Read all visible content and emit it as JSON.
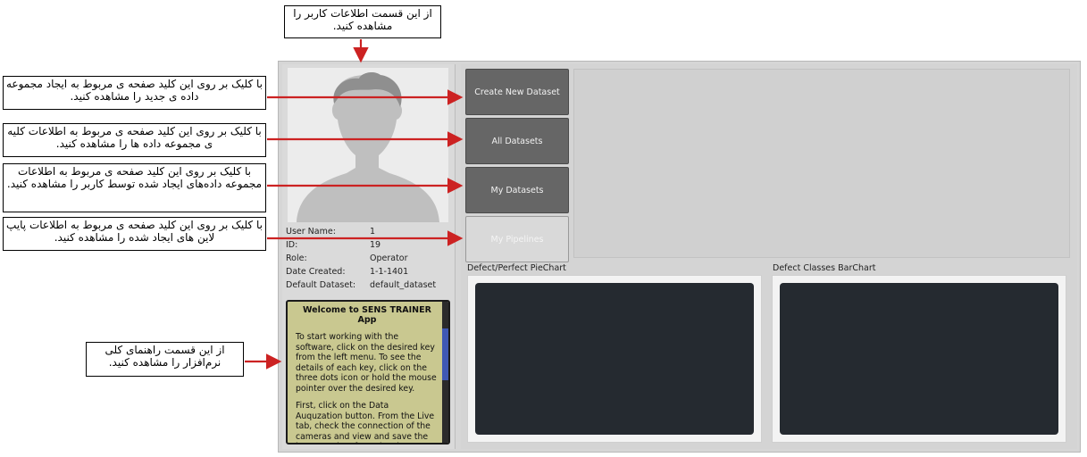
{
  "user_info": {
    "rows": [
      {
        "label": "User Name:",
        "value": "1"
      },
      {
        "label": "ID:",
        "value": "19"
      },
      {
        "label": "Role:",
        "value": "Operator"
      },
      {
        "label": "Date Created:",
        "value": "1-1-1401"
      },
      {
        "label": "Default Dataset:",
        "value": "default_dataset"
      }
    ]
  },
  "menu": {
    "create_new_dataset": "Create New Dataset",
    "all_datasets": "All Datasets",
    "my_datasets": "My Datasets",
    "my_pipelines": "My Pipelines"
  },
  "help": {
    "title": "Welcome to SENS TRAINER App",
    "paragraph1": "To start working with the software, click on the desired key from the left menu. To see the details of each key, click on the three dots icon or hold the mouse pointer over the desired key.",
    "paragraph2": "First, click on the Data Auquzation button. From the Live tab, check the connection of the cameras and view and save the images taken from the sheets live."
  },
  "charts": {
    "pie_label": "Defect/Perfect PieChart",
    "bar_label": "Defect Classes BarChart"
  },
  "callouts": {
    "user_info": "از این قسمت اطلاعات کاربر را مشاهده کنید.",
    "create_dataset": "با کلیک بر روی این کلید صفحه ی مربوط به ایجاد مجموعه داده ی جدید را مشاهده کنید.",
    "all_datasets": "با کلیک بر روی این کلید صفحه ی مربوط به اطلاعات کلیه ی مجموعه داده ها را مشاهده کنید.",
    "my_datasets": "با کلیک بر روی این کلید صفحه ی مربوط به اطلاعات مجموعه داده‌های ایجاد شده توسط کاربر را مشاهده کنید.",
    "my_pipelines": "با کلیک بر روی این کلید صفحه ی مربوط به اطلاعات پایپ لاین های ایجاد شده را مشاهده کنید.",
    "help": "از این قسمت راهنمای کلی نرم‌افزار را مشاهده کنید."
  },
  "colors": {
    "arrow": "#cc2222",
    "help_bg": "#c9c890",
    "button_dark": "#666666",
    "chart_bg": "#252a30"
  }
}
